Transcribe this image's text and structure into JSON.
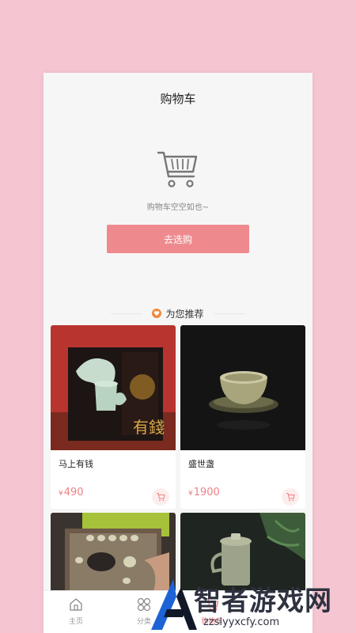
{
  "header": {
    "title": "购物车"
  },
  "empty_cart": {
    "icon": "shopping-cart-icon",
    "message": "购物车空空如也~",
    "button_label": "去选购"
  },
  "recommend": {
    "title": "为您推荐",
    "icon": "heart-icon"
  },
  "products": [
    {
      "name": "马上有钱",
      "price": "490",
      "currency": "¥"
    },
    {
      "name": "盛世盏",
      "price": "1900",
      "currency": "¥"
    },
    {
      "name": "",
      "price": "",
      "currency": ""
    },
    {
      "name": "",
      "price": "",
      "currency": ""
    }
  ],
  "tabbar": {
    "items": [
      {
        "label": "主页",
        "icon": "home-icon"
      },
      {
        "label": "分类",
        "icon": "category-icon"
      },
      {
        "label": "购物车",
        "icon": "cart-icon"
      }
    ]
  },
  "watermark": {
    "brand": "智者游戏网",
    "url": "zzslyyxcfy.com"
  },
  "colors": {
    "accent": "#ee8a8e",
    "background": "#f5c6d1",
    "price": "#ef7f82"
  }
}
